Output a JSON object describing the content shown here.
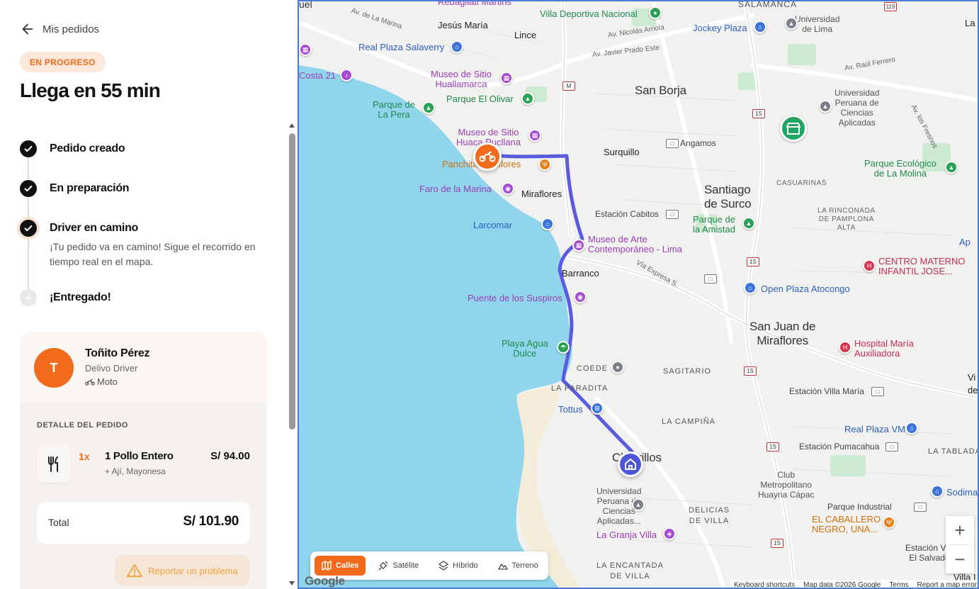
{
  "header": {
    "back_label": "Mis pedidos"
  },
  "status": {
    "badge": "EN PROGRESO",
    "eta": "Llega en 55 min"
  },
  "steps": [
    {
      "title": "Pedido creado",
      "state": "done"
    },
    {
      "title": "En preparación",
      "state": "done"
    },
    {
      "title": "Driver en camino",
      "state": "active",
      "desc": "¡Tu pedido va en camino! Sigue el recorrido en tiempo real en el mapa."
    },
    {
      "title": "¡Entregado!",
      "state": "pending",
      "number": "4"
    }
  ],
  "driver": {
    "initial": "T",
    "name": "Toñito Pérez",
    "role": "Delivo Driver",
    "vehicle": "Moto"
  },
  "order": {
    "label": "DETALLE DEL PEDIDO",
    "items": [
      {
        "qty": "1x",
        "name": "1 Pollo Entero",
        "extras": "+ Ají, Mayonesa",
        "price": "S/ 94.00"
      }
    ],
    "total_label": "Total",
    "total_value": "S/ 101.90",
    "report_label": "Reportar un problema"
  },
  "map": {
    "labels": {
      "jesus_maria": "Jesús María",
      "lince": "Lince",
      "san_borja": "San Borja",
      "surquillo": "Surquillo",
      "miraflores": "Miraflores",
      "santiago": "Santiago\nde Surco",
      "barranco": "Barranco",
      "sjm": "San Juan de\nMiraflores",
      "chorrillos": "Chorrillos",
      "sagitario": "SAGITARIO",
      "la_campina": "LA CAMPIÑA",
      "la_paradita": "LA PARADITA",
      "coede": "COEDE",
      "delicias": "DELICIAS\nDE VILLA",
      "encantada": "LA ENCANTADA\nDE VILLA",
      "la_tablada": "LA TABLADA",
      "casuarinas": "CASUARINAS",
      "rinconada": "LA RINCONADA\nDE PAMPLONA\nALTA",
      "villa_partial": "Villa I",
      "vi_partial": "Vi\nde",
      "la_moli": "La Moli",
      "ap": "Ap",
      "av_marina": "Av. de La Marina",
      "av_javier": "Av. Javier Prado Este",
      "av_raul": "Av. Raúl Ferrero",
      "av_nicolas": "Av. Nicolás Arriola",
      "av_fresnos": "Av. los Fresnos",
      "via_expresa": "Vía Expresa S.",
      "salaverry": "Real Plaza Salaverry",
      "hualla": "Museo de Sitio\nHuallamarca",
      "costa21": "Costa 21",
      "olivar": "Parque El Olivar",
      "la_pera": "Parque de\nLa Pera",
      "pucllana": "Museo de Sitio\nHuaca Pucllana",
      "panchita": "Panchita Miraflores",
      "faro": "Faro de la Marina",
      "larcomar": "Larcomar",
      "museo_arte": "Museo de Arte\nContemporáneo - Lima",
      "puente": "Puente de los Suspiros",
      "playa": "Playa Agua\nDulce",
      "tottus": "Tottus",
      "upc": "Universidad\nPeruana de\nCiencias\nAplicadas...",
      "granja": "La Granja Villa",
      "villa_deportiva": "Villa Deportiva Nacional",
      "jockey": "Jockey Plaza",
      "u_lima": "Universidad\nde Lima",
      "upc2": "Universidad\nPeruana de\nCiencias\nAplicadas",
      "parque_molina": "Parque Ecológico\nde La Molina",
      "angamos": "Angamos",
      "cabitos": "Estación Cabitos",
      "amistad": "Parque de\nla Amistad",
      "centro_materno": "CENTRO MATERNO\nINFANTIL JOSE...",
      "atocongo": "Open Plaza Atocongo",
      "hospital": "Hospital María\nAuxiliadora",
      "villa_maria": "Estación Villa María",
      "vmt": "Real Plaza VMT",
      "pumacahua": "Estación Pumacahua",
      "club": "Club\nMetropolitano\nHuayna Cápac",
      "parque_ind": "Parque Industrial",
      "caballero": "EL CABALLERO\nNEGRO, UNA...",
      "villa_el_salvador": "Estación Villa\nEl Salvador",
      "sodima": "Sodima",
      "salamanca": "SALAMANCA",
      "rebagliati": "Rebagliati Martins",
      "uel": "uel"
    },
    "route_shields": {
      "m": "M",
      "s1": "1S",
      "s2": "119"
    },
    "map_types": [
      "Calles",
      "Satélite",
      "Híbrido",
      "Terreno"
    ],
    "active_map_type": "Calles",
    "zoom_in": "+",
    "zoom_out": "−",
    "google": "Google",
    "attribution": {
      "shortcuts": "Keyboard shortcuts",
      "data": "Map data ©2026 Google",
      "terms": "Terms",
      "report": "Report a map error"
    },
    "colors": {
      "water": "#8fd6ec",
      "route": "#5b5be0",
      "accent": "#f26b1d"
    }
  }
}
